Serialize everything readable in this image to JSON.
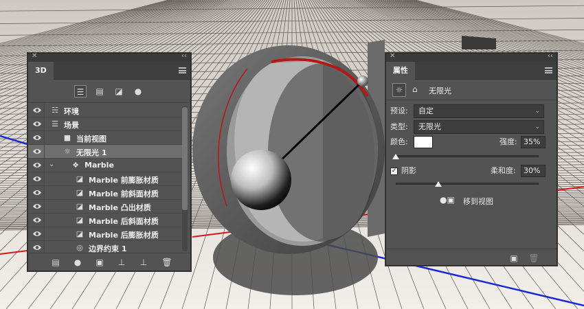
{
  "panel_3d": {
    "tab": "3D",
    "filters": [
      {
        "icon": "scene-filter-icon",
        "active": true
      },
      {
        "icon": "mesh-filter-icon",
        "active": false
      },
      {
        "icon": "material-filter-icon",
        "active": false
      },
      {
        "icon": "light-filter-icon",
        "active": false
      }
    ],
    "rows": [
      {
        "label": "环境",
        "icon": "environment-icon",
        "indent": 0
      },
      {
        "label": "场景",
        "icon": "scene-icon",
        "indent": 0
      },
      {
        "label": "当前视图",
        "icon": "camera-icon",
        "indent": 1
      },
      {
        "label": "无限光 1",
        "icon": "infinite-light-icon",
        "indent": 1,
        "selected": true
      },
      {
        "label": "Marble",
        "icon": "mesh-icon",
        "indent": 1,
        "expanded": true
      },
      {
        "label": "Marble 前膨胀材质",
        "icon": "material-icon",
        "indent": 2
      },
      {
        "label": "Marble 前斜面材质",
        "icon": "material-icon",
        "indent": 2
      },
      {
        "label": "Marble 凸出材质",
        "icon": "material-icon",
        "indent": 2
      },
      {
        "label": "Marble 后斜面材质",
        "icon": "material-icon",
        "indent": 2
      },
      {
        "label": "Marble 后膨胀材质",
        "icon": "material-icon",
        "indent": 2
      },
      {
        "label": "边界约束 1",
        "icon": "constraint-icon",
        "indent": 2
      }
    ]
  },
  "panel_props": {
    "tab": "属性",
    "light_name": "无限光",
    "preset_label": "预设:",
    "preset_value": "自定",
    "type_label": "类型:",
    "type_value": "无限光",
    "color_label": "颜色:",
    "color_value": "#ffffff",
    "intensity_label": "强度:",
    "intensity_value": "35%",
    "intensity_fraction": 0.0,
    "shadow_label": "阴影",
    "shadow_checked": true,
    "softness_label": "柔和度:",
    "softness_value": "30%",
    "softness_fraction": 0.3,
    "move_to_view_label": "移到视图"
  }
}
